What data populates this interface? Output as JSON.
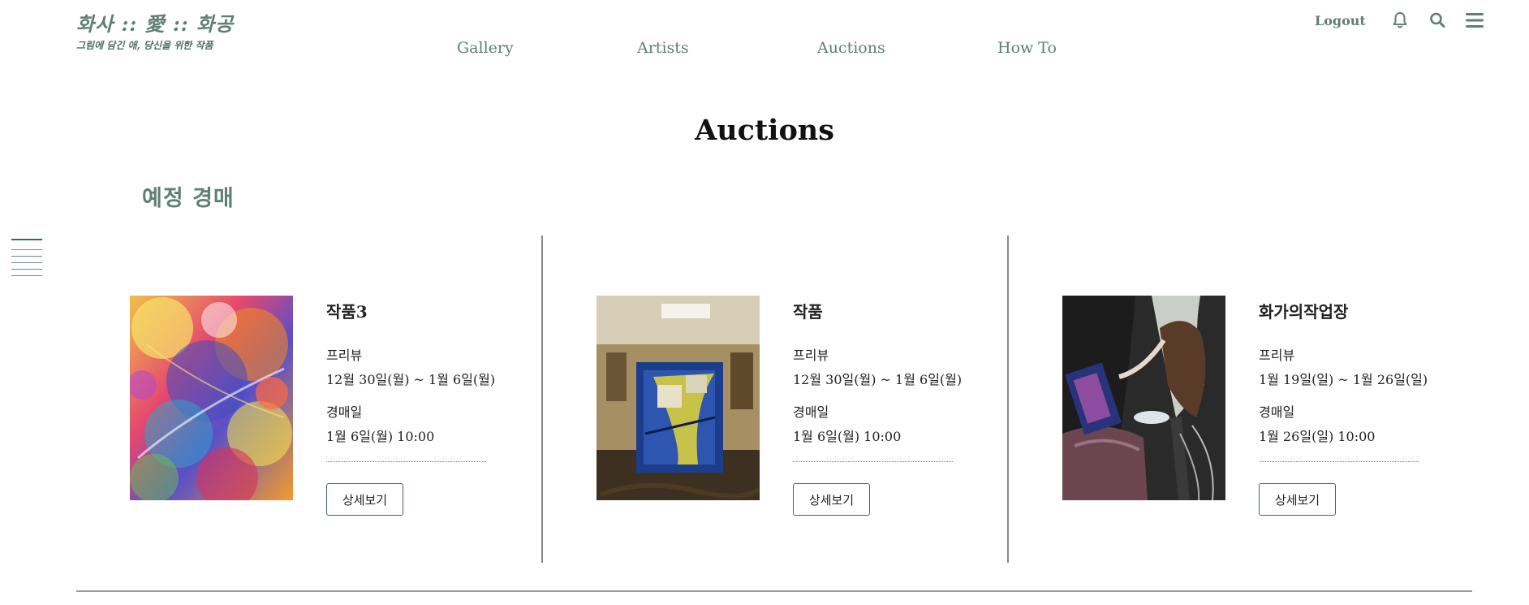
{
  "brand": {
    "title": "화사 :: 愛 :: 화공",
    "subtitle": "그림에 담긴 애, 당신을 위한 작품"
  },
  "nav": [
    {
      "label": "Gallery"
    },
    {
      "label": "Artists"
    },
    {
      "label": "Auctions"
    },
    {
      "label": "How To"
    }
  ],
  "topbar": {
    "logout": "Logout",
    "icons": [
      "bell-icon",
      "search-icon",
      "menu-icon"
    ]
  },
  "page": {
    "title": "Auctions",
    "section_title": "예정 경매"
  },
  "colors": {
    "accent": "#5e7f74",
    "dark_accent": "#2f6e59",
    "divider": "#888888"
  },
  "auctions": [
    {
      "title": "작품3",
      "preview_label": "프리뷰",
      "preview_dates": "12월 30일(월) ~ 1월 6일(월)",
      "auction_label": "경매일",
      "auction_date": "1월 6일(월) 10:00",
      "button": "상세보기",
      "image": "colorful-abstract-painting"
    },
    {
      "title": "작품",
      "preview_label": "프리뷰",
      "preview_dates": "12월 30일(월) ~ 1월 6일(월)",
      "auction_label": "경매일",
      "auction_date": "1월 6일(월) 10:00",
      "button": "상세보기",
      "image": "painting-in-abandoned-room"
    },
    {
      "title": "화가의작업장",
      "preview_label": "프리뷰",
      "preview_dates": "1월 19일(일) ~ 1월 26일(일)",
      "auction_label": "경매일",
      "auction_date": "1월 26일(일) 10:00",
      "button": "상세보기",
      "image": "painter-at-work-photo"
    }
  ]
}
